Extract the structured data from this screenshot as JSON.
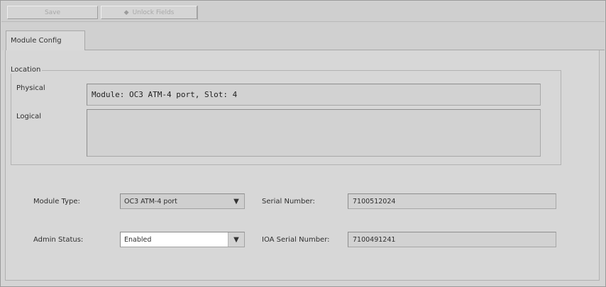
{
  "toolbar": {
    "save_label": "Save",
    "unlock_label": "Unlock Fields",
    "unlock_icon": "lock-icon"
  },
  "tabs": [
    {
      "label": "Module Config",
      "active": true
    }
  ],
  "location": {
    "legend": "Location",
    "physical_label": "Physical",
    "physical_value": "Module: OC3 ATM-4 port, Slot: 4",
    "logical_label": "Logical",
    "logical_value": ""
  },
  "details": {
    "module_type_label": "Module Type:",
    "module_type_value": "OC3 ATM-4 port",
    "admin_status_label": "Admin Status:",
    "admin_status_value": "Enabled",
    "serial_number_label": "Serial Number:",
    "serial_number_value": "7100512024",
    "ioa_serial_label": "IOA Serial Number:",
    "ioa_serial_value": "7100491241"
  },
  "colors": {
    "background": "#d4d4d4",
    "field_background": "#d2d2d2",
    "disabled_text": "#a8a8a8"
  }
}
